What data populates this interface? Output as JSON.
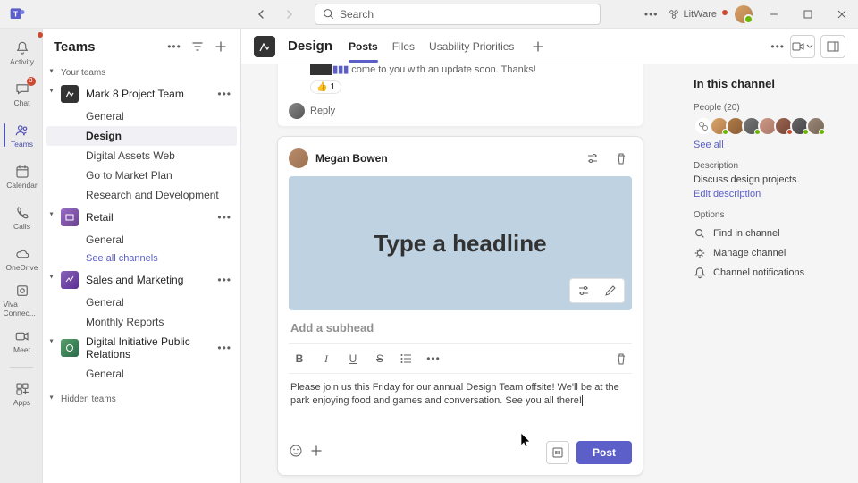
{
  "titlebar": {
    "search_placeholder": "Search",
    "tenant": "LitWare"
  },
  "rail": [
    {
      "id": "activity",
      "label": "Activity"
    },
    {
      "id": "chat",
      "label": "Chat"
    },
    {
      "id": "teams",
      "label": "Teams"
    },
    {
      "id": "calendar",
      "label": "Calendar"
    },
    {
      "id": "calls",
      "label": "Calls"
    },
    {
      "id": "onedrive",
      "label": "OneDrive"
    },
    {
      "id": "viva",
      "label": "Viva Connec..."
    },
    {
      "id": "meet",
      "label": "Meet"
    }
  ],
  "rail_apps": "Apps",
  "teams_header": "Teams",
  "your_teams": "Your teams",
  "teams": [
    {
      "name": "Mark 8 Project Team",
      "color": "#3b3b3b",
      "channels": [
        "General",
        "Design",
        "Digital Assets Web",
        "Go to Market Plan",
        "Research and Development"
      ],
      "active_channel": "Design"
    },
    {
      "name": "Retail",
      "color": "#6a418f",
      "channels": [
        "General",
        "See all channels"
      ]
    },
    {
      "name": "Sales and Marketing",
      "color": "#5c2e91",
      "channels": [
        "General",
        "Monthly Reports"
      ]
    },
    {
      "name": "Digital Initiative Public Relations",
      "color": "#2b6a4a",
      "channels": [
        "General"
      ]
    }
  ],
  "hidden_teams": "Hidden teams",
  "channel_header": {
    "name": "Design",
    "tabs": [
      "Posts",
      "Files",
      "Usability Priorities"
    ],
    "active_tab": "Posts"
  },
  "prev_message": {
    "snippet": "come to you with an update soon. Thanks!",
    "reaction_count": 1,
    "reply": "Reply"
  },
  "composer": {
    "author": "Megan Bowen",
    "headline_placeholder": "Type a headline",
    "subhead_placeholder": "Add a subhead",
    "body": "Please join us this Friday for our annual Design Team offsite! We'll be at the park enjoying food and games and conversation. See you all there!",
    "post_label": "Post"
  },
  "right": {
    "heading": "In this channel",
    "people_label": "People (20)",
    "see_all": "See all",
    "desc_label": "Description",
    "desc": "Discuss design projects.",
    "edit_desc": "Edit description",
    "options_label": "Options",
    "options": [
      "Find in channel",
      "Manage channel",
      "Channel notifications"
    ]
  }
}
